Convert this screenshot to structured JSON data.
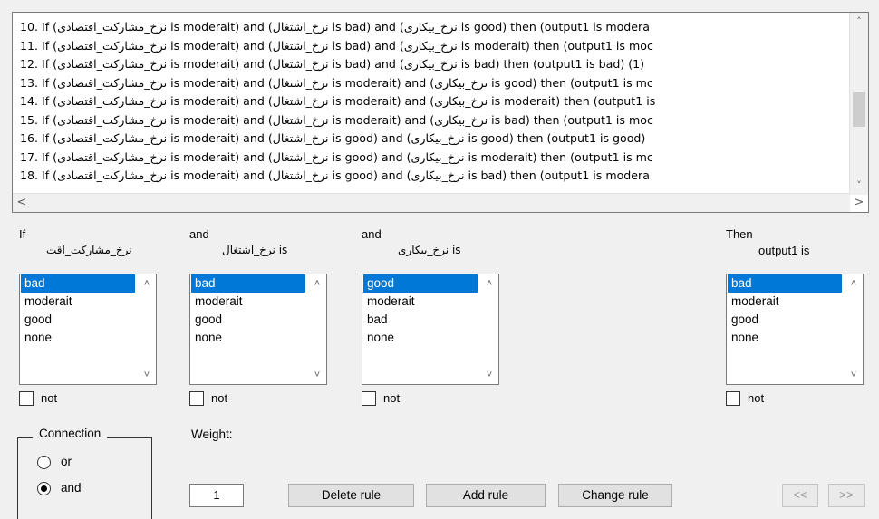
{
  "rules_list": {
    "lines": [
      {
        "a": "10. If (",
        "v1": "نرخ_مشارکت_اقتصادی",
        "b": " is moderait) and (",
        "v2": "نرخ_اشتغال",
        "c": " is bad) and (",
        "v3": "نرخ_بیکاری",
        "d": " is good) then (output1 is modera"
      },
      {
        "a": "11. If (",
        "v1": "نرخ_مشارکت_اقتصادی",
        "b": " is moderait) and (",
        "v2": "نرخ_اشتغال",
        "c": " is bad) and (",
        "v3": "نرخ_بیکاری",
        "d": " is moderait) then (output1 is moc"
      },
      {
        "a": "12. If (",
        "v1": "نرخ_مشارکت_اقتصادی",
        "b": " is moderait) and (",
        "v2": "نرخ_اشتغال",
        "c": " is bad) and (",
        "v3": "نرخ_بیکاری",
        "d": " is bad) then (output1 is bad) (1)"
      },
      {
        "a": "13. If (",
        "v1": "نرخ_مشارکت_اقتصادی",
        "b": " is moderait) and (",
        "v2": "نرخ_اشتغال",
        "c": " is moderait) and (",
        "v3": "نرخ_بیکاری",
        "d": " is good) then (output1 is mc"
      },
      {
        "a": "14. If (",
        "v1": "نرخ_مشارکت_اقتصادی",
        "b": " is moderait) and (",
        "v2": "نرخ_اشتغال",
        "c": " is moderait) and (",
        "v3": "نرخ_بیکاری",
        "d": " is moderait) then (output1 is"
      },
      {
        "a": "15. If (",
        "v1": "نرخ_مشارکت_اقتصادی",
        "b": " is moderait) and (",
        "v2": "نرخ_اشتغال",
        "c": " is moderait) and (",
        "v3": "نرخ_بیکاری",
        "d": " is bad) then (output1 is moc"
      },
      {
        "a": "16. If (",
        "v1": "نرخ_مشارکت_اقتصادی",
        "b": " is moderait) and (",
        "v2": "نرخ_اشتغال",
        "c": " is good) and (",
        "v3": "نرخ_بیکاری",
        "d": " is good) then (output1 is good)"
      },
      {
        "a": "17. If (",
        "v1": "نرخ_مشارکت_اقتصادی",
        "b": " is moderait) and (",
        "v2": "نرخ_اشتغال",
        "c": " is good) and (",
        "v3": "نرخ_بیکاری",
        "d": " is moderait) then (output1 is mc"
      },
      {
        "a": "18. If (",
        "v1": "نرخ_مشارکت_اقتصادی",
        "b": " is moderait) and (",
        "v2": "نرخ_اشتغال",
        "c": " is good) and (",
        "v3": "نرخ_بیکاری",
        "d": " is bad) then (output1 is modera"
      }
    ],
    "scroll_up_icon": "chevron-up-icon",
    "scroll_down_icon": "chevron-down-icon",
    "scroll_left_icon": "chevron-left-icon",
    "scroll_right_icon": "chevron-right-icon"
  },
  "columns": [
    {
      "head": "If",
      "var": "نرخ_مشارکت_اقت",
      "suffix": "",
      "items": [
        "bad",
        "moderait",
        "good",
        "none"
      ],
      "selected": "bad",
      "not_label": "not"
    },
    {
      "head": "and",
      "var": "نرخ_اشتغال",
      "suffix": " is",
      "items": [
        "bad",
        "moderait",
        "good",
        "none"
      ],
      "selected": "bad",
      "not_label": "not"
    },
    {
      "head": "and",
      "var": "نرخ_بیکاری",
      "suffix": " is",
      "items": [
        "good",
        "moderait",
        "bad",
        "none"
      ],
      "selected": "good",
      "not_label": "not"
    },
    {
      "head": "Then",
      "var": "output1 is",
      "suffix": "",
      "items": [
        "bad",
        "moderait",
        "good",
        "none"
      ],
      "selected": "bad",
      "not_label": "not"
    }
  ],
  "connection": {
    "title": "Connection",
    "options": [
      "or",
      "and"
    ],
    "selected": "and"
  },
  "weight": {
    "label": "Weight:",
    "value": "1"
  },
  "buttons": {
    "delete": "Delete rule",
    "add": "Add rule",
    "change": "Change rule",
    "prev": "<<",
    "next": ">>"
  },
  "colors": {
    "selection": "#0078d7",
    "background": "#f0f0f0"
  }
}
